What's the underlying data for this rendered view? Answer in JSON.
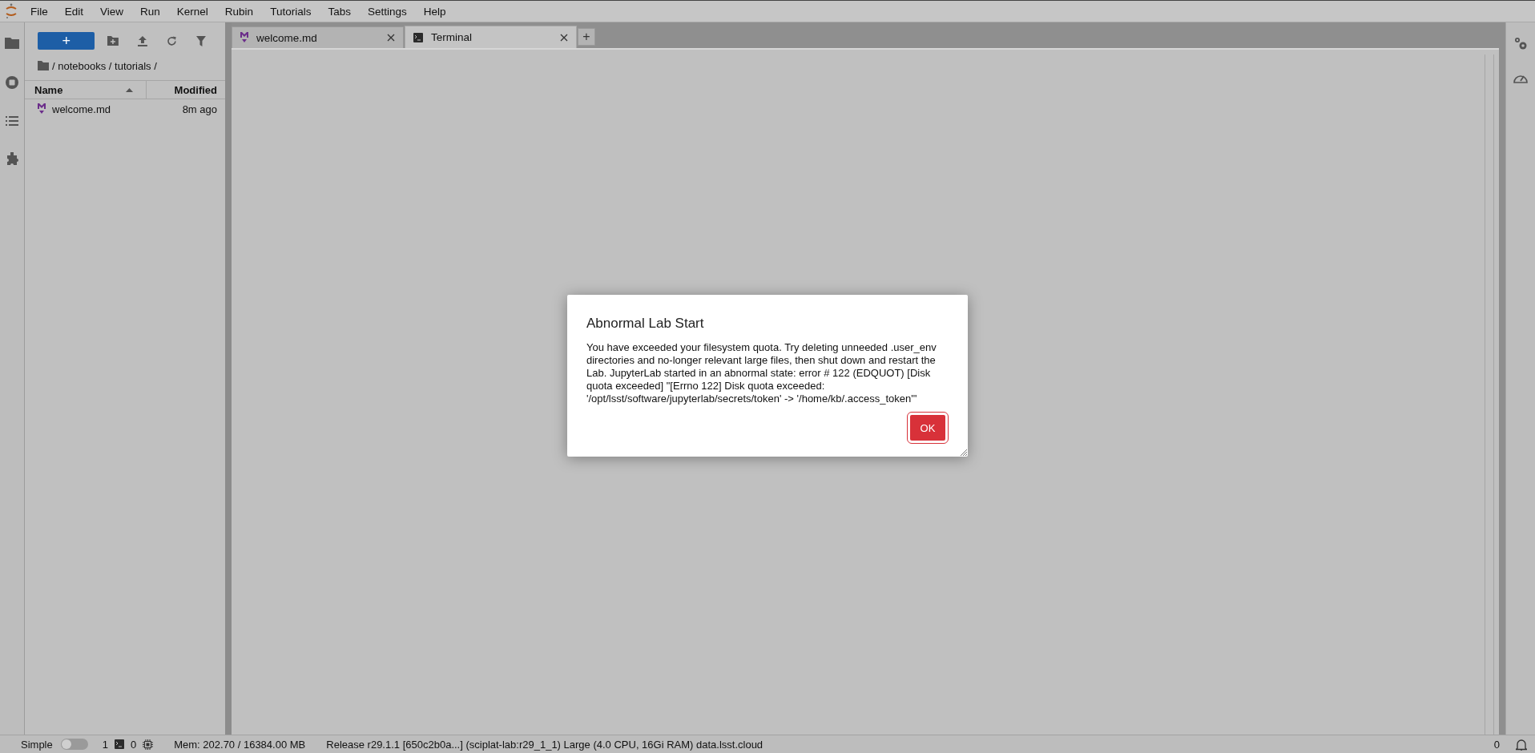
{
  "menu_bar": {
    "items": [
      "File",
      "Edit",
      "View",
      "Run",
      "Kernel",
      "Rubin",
      "Tutorials",
      "Tabs",
      "Settings",
      "Help"
    ]
  },
  "file_browser": {
    "new_button": "+",
    "breadcrumb": "/ notebooks / tutorials /",
    "columns": [
      {
        "label": "Name",
        "sorted": true
      },
      {
        "label": "Modified",
        "sorted": false
      }
    ],
    "files": [
      {
        "name": "welcome.md",
        "modified": "8m ago",
        "selected": false
      }
    ]
  },
  "tabs": [
    {
      "label": "welcome.md",
      "kind": "markdown",
      "selected": false
    },
    {
      "label": "Terminal",
      "kind": "terminal",
      "selected": true
    }
  ],
  "add_tab": "+",
  "dialog": {
    "title": "Abnormal Lab Start",
    "body": "You have exceeded your filesystem quota. Try deleting unneeded .user_env directories and no-longer relevant large files, then shut down and restart the Lab. JupyterLab started in an abnormal state: error # 122 (EDQUOT) [Disk quota exceeded] \"[Errno 122] Disk quota exceeded: '/opt/lsst/software/jupyterlab/secrets/token' -> '/home/kb/.access_token'\"",
    "button": "OK"
  },
  "status_bar": {
    "mode_label": "Simple",
    "simple_mode": false,
    "terminals": "1",
    "kernels": "0",
    "memory": "Mem: 202.70 / 16384.00 MB",
    "release": "Release r29.1.1 [650c2b0a...] (sciplat-lab:r29_1_1) Large (4.0 CPU, 16Gi RAM) data.lsst.cloud",
    "notifications": "0"
  }
}
